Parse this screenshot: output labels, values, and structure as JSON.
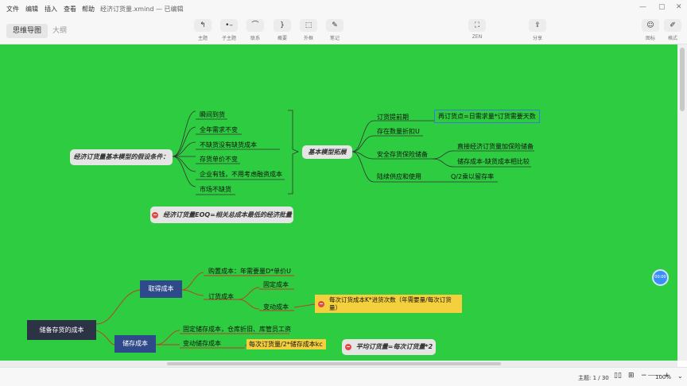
{
  "menubar": {
    "items": [
      "文件",
      "编辑",
      "插入",
      "查看",
      "帮助"
    ],
    "doc_title": "经济订货量.xmind — 已编辑"
  },
  "toolbar": {
    "tabs": {
      "mindmap": "思维导图",
      "outline": "大纲"
    },
    "tools": {
      "topic": "主题",
      "subtopic": "子主题",
      "relation": "联系",
      "summary": "概要",
      "boundary": "外框",
      "note": "笔记",
      "zen": "ZEN",
      "share": "分享",
      "icon": "图标",
      "format": "格式"
    }
  },
  "mindmap": {
    "assumptions_title": "经济订货量基本模型的假设条件：",
    "assumptions": [
      "瞬间到货",
      "全年需求不变",
      "不缺货没有缺货成本",
      "存货单价不变",
      "企业有钱，不用考虑融资成本",
      "市场不缺货"
    ],
    "extension_title": "基本模型拓展",
    "extensions": {
      "lead_time": "订货提前期",
      "reorder_point": "再订货点=日需求量*订货需要天数",
      "discount": "存在数量折扣U",
      "safety_stock": "安全存货保险储备",
      "direct_eoq": "直接经济订货量加保险储备",
      "compare": "储存成本-缺货成本相比较",
      "continuous": "陆续供应和使用",
      "retention": "Q/2乘以留存率"
    },
    "eoq_note": "经济订货量EOQ=相关总成本最低的经济批量",
    "root2": "储备存货的成本",
    "acquire_cost": "取得成本",
    "purchase_cost": "购置成本：年需要量D*单价U",
    "order_cost": "订货成本",
    "fixed_cost": "固定成本",
    "variable_cost": "变动成本",
    "variable_formula": "每次订货成本K*进货次数（年需要量/每次订货量）",
    "storage_cost": "储存成本",
    "fixed_storage": "固定储存成本，仓库折旧、库管员工资",
    "variable_storage": "变动储存成本",
    "variable_storage_formula": "每次订货量/2*储存成本kc",
    "avg_note": "平均订货量=每次订货量*2"
  },
  "float_button": "00:00",
  "statusbar": {
    "topics": "主题: 1 / 30",
    "zoom": "100%",
    "minus": "−",
    "plus": "+"
  },
  "colors": {
    "canvas": "#2ecc40",
    "navy": "#2f4a8a",
    "yellow": "#f4d03f",
    "dark": "#2b3344",
    "marker": "#e84545"
  }
}
